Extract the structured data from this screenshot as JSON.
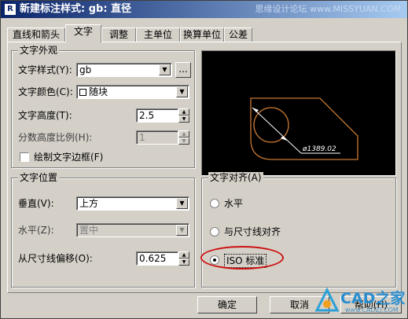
{
  "window": {
    "title": "新建标注样式: gb: 直径",
    "watermark": "思缘设计论坛  www.MISSYUAN.COM",
    "title_icon": "autocad-app-icon"
  },
  "tabs": [
    {
      "label": "直线和箭头",
      "active": false
    },
    {
      "label": "文字",
      "active": true
    },
    {
      "label": "调整",
      "active": false
    },
    {
      "label": "主单位",
      "active": false
    },
    {
      "label": "换算单位",
      "active": false
    },
    {
      "label": "公差",
      "active": false
    }
  ],
  "text_appearance": {
    "group_title": "文字外观",
    "style_label": "文字样式(Y):",
    "style_value": "gb",
    "browse_label": "...",
    "color_label": "文字颜色(C):",
    "color_value": "随块",
    "height_label": "文字高度(T):",
    "height_value": "2.5",
    "fraction_label": "分数高度比例(H):",
    "fraction_value": "1",
    "frame_label": "绘制文字边框(F)",
    "frame_checked": false
  },
  "preview": {
    "dimension_text": "ø1389.02",
    "line_color": "#c87832"
  },
  "text_placement": {
    "group_title": "文字位置",
    "vertical_label": "垂直(V):",
    "vertical_value": "上方",
    "horizontal_label": "水平(Z):",
    "horizontal_value": "置中",
    "offset_label": "从尺寸线偏移(O):",
    "offset_value": "0.625"
  },
  "text_alignment": {
    "group_title": "文字对齐(A)",
    "options": [
      {
        "label": "水平",
        "selected": false
      },
      {
        "label": "与尺寸线对齐",
        "selected": false
      },
      {
        "label": "ISO 标准",
        "selected": true
      }
    ],
    "highlight_color": "#cc1010"
  },
  "footer": {
    "ok_label": "确定",
    "cancel_label": "取消",
    "help_label": "帮助(H)",
    "logo_text": "CAD之家",
    "logo_url_text": "www.CADZJ.COM"
  }
}
